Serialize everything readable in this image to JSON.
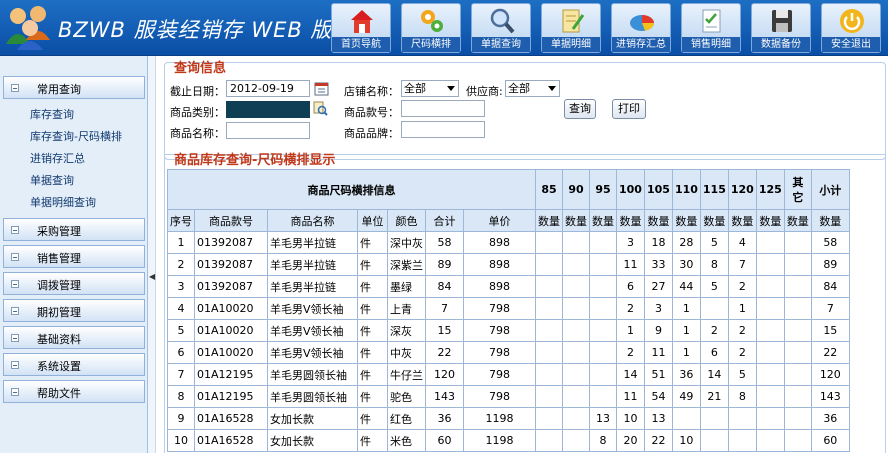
{
  "app": {
    "title": "BZWB 服装经销存 WEB 版"
  },
  "nav": [
    {
      "label": "首页导航",
      "icon": "home-icon"
    },
    {
      "label": "尺码横排",
      "icon": "gears-icon"
    },
    {
      "label": "单据查询",
      "icon": "magnifier-icon"
    },
    {
      "label": "单据明细",
      "icon": "notepad-icon"
    },
    {
      "label": "进销存汇总",
      "icon": "pie-chart-icon"
    },
    {
      "label": "销售明细",
      "icon": "checklist-icon"
    },
    {
      "label": "数据备份",
      "icon": "floppy-disk-icon"
    },
    {
      "label": "安全退出",
      "icon": "power-icon"
    }
  ],
  "sidebar": {
    "open_group": "常用查询",
    "sub_items": [
      "库存查询",
      "库存查询-尺码横排",
      "进销存汇总",
      "单据查询",
      "单据明细查询"
    ],
    "groups": [
      "采购管理",
      "销售管理",
      "调拨管理",
      "期初管理",
      "基础资料",
      "系统设置",
      "帮助文件"
    ]
  },
  "query": {
    "title": "查询信息",
    "date_label": "截止日期：",
    "date_value": "2012-09-19",
    "store_label": "店铺名称：",
    "store_value": "全部",
    "supplier_label": "供应商:",
    "supplier_value": "全部",
    "category_label": "商品类别：",
    "style_label": "商品款号：",
    "name_label": "商品名称：",
    "brand_label": "商品品牌：",
    "search_button": "查询",
    "print_button": "打印"
  },
  "result": {
    "title": "商品库存查询-尺码横排显示",
    "group_header": "商品尺码横排信息",
    "sizes": [
      "85",
      "90",
      "95",
      "100",
      "105",
      "110",
      "115",
      "120",
      "125",
      "其它"
    ],
    "subtotal_label": "小计",
    "columns": [
      "序号",
      "商品款号",
      "商品名称",
      "单位",
      "颜色",
      "合计",
      "单价"
    ],
    "qty_label": "数量",
    "rows": [
      {
        "no": "1",
        "code": "01392087",
        "name": "羊毛男半拉链",
        "unit": "件",
        "color": "深中灰",
        "total": "58",
        "price": "898",
        "sizes": [
          "",
          "",
          "",
          "3",
          "18",
          "28",
          "5",
          "4",
          "",
          ""
        ],
        "subtotal": "58"
      },
      {
        "no": "2",
        "code": "01392087",
        "name": "羊毛男半拉链",
        "unit": "件",
        "color": "深紫兰",
        "total": "89",
        "price": "898",
        "sizes": [
          "",
          "",
          "",
          "11",
          "33",
          "30",
          "8",
          "7",
          "",
          ""
        ],
        "subtotal": "89"
      },
      {
        "no": "3",
        "code": "01392087",
        "name": "羊毛男半拉链",
        "unit": "件",
        "color": "墨绿",
        "total": "84",
        "price": "898",
        "sizes": [
          "",
          "",
          "",
          "6",
          "27",
          "44",
          "5",
          "2",
          "",
          ""
        ],
        "subtotal": "84"
      },
      {
        "no": "4",
        "code": "01A10020",
        "name": "羊毛男V领长袖",
        "unit": "件",
        "color": "上青",
        "total": "7",
        "price": "798",
        "sizes": [
          "",
          "",
          "",
          "2",
          "3",
          "1",
          "",
          "1",
          "",
          ""
        ],
        "subtotal": "7"
      },
      {
        "no": "5",
        "code": "01A10020",
        "name": "羊毛男V领长袖",
        "unit": "件",
        "color": "深灰",
        "total": "15",
        "price": "798",
        "sizes": [
          "",
          "",
          "",
          "1",
          "9",
          "1",
          "2",
          "2",
          "",
          ""
        ],
        "subtotal": "15"
      },
      {
        "no": "6",
        "code": "01A10020",
        "name": "羊毛男V领长袖",
        "unit": "件",
        "color": "中灰",
        "total": "22",
        "price": "798",
        "sizes": [
          "",
          "",
          "",
          "2",
          "11",
          "1",
          "6",
          "2",
          "",
          ""
        ],
        "subtotal": "22"
      },
      {
        "no": "7",
        "code": "01A12195",
        "name": "羊毛男圆领长袖",
        "unit": "件",
        "color": "牛仔兰",
        "total": "120",
        "price": "798",
        "sizes": [
          "",
          "",
          "",
          "14",
          "51",
          "36",
          "14",
          "5",
          "",
          ""
        ],
        "subtotal": "120"
      },
      {
        "no": "8",
        "code": "01A12195",
        "name": "羊毛男圆领长袖",
        "unit": "件",
        "color": "驼色",
        "total": "143",
        "price": "798",
        "sizes": [
          "",
          "",
          "",
          "11",
          "54",
          "49",
          "21",
          "8",
          "",
          ""
        ],
        "subtotal": "143"
      },
      {
        "no": "9",
        "code": "01A16528",
        "name": "女加长款",
        "unit": "件",
        "color": "红色",
        "total": "36",
        "price": "1198",
        "sizes": [
          "",
          "",
          "13",
          "10",
          "13",
          "",
          "",
          "",
          "",
          ""
        ],
        "subtotal": "36"
      },
      {
        "no": "10",
        "code": "01A16528",
        "name": "女加长款",
        "unit": "件",
        "color": "米色",
        "total": "60",
        "price": "1198",
        "sizes": [
          "",
          "",
          "8",
          "20",
          "22",
          "10",
          "",
          "",
          "",
          ""
        ],
        "subtotal": "60"
      }
    ]
  },
  "colors": {
    "header_blue": "#0b4ea6",
    "section_title": "#c0381a",
    "table_header": "#d9e7f6",
    "sidebar_bg": "#e4eef9"
  }
}
